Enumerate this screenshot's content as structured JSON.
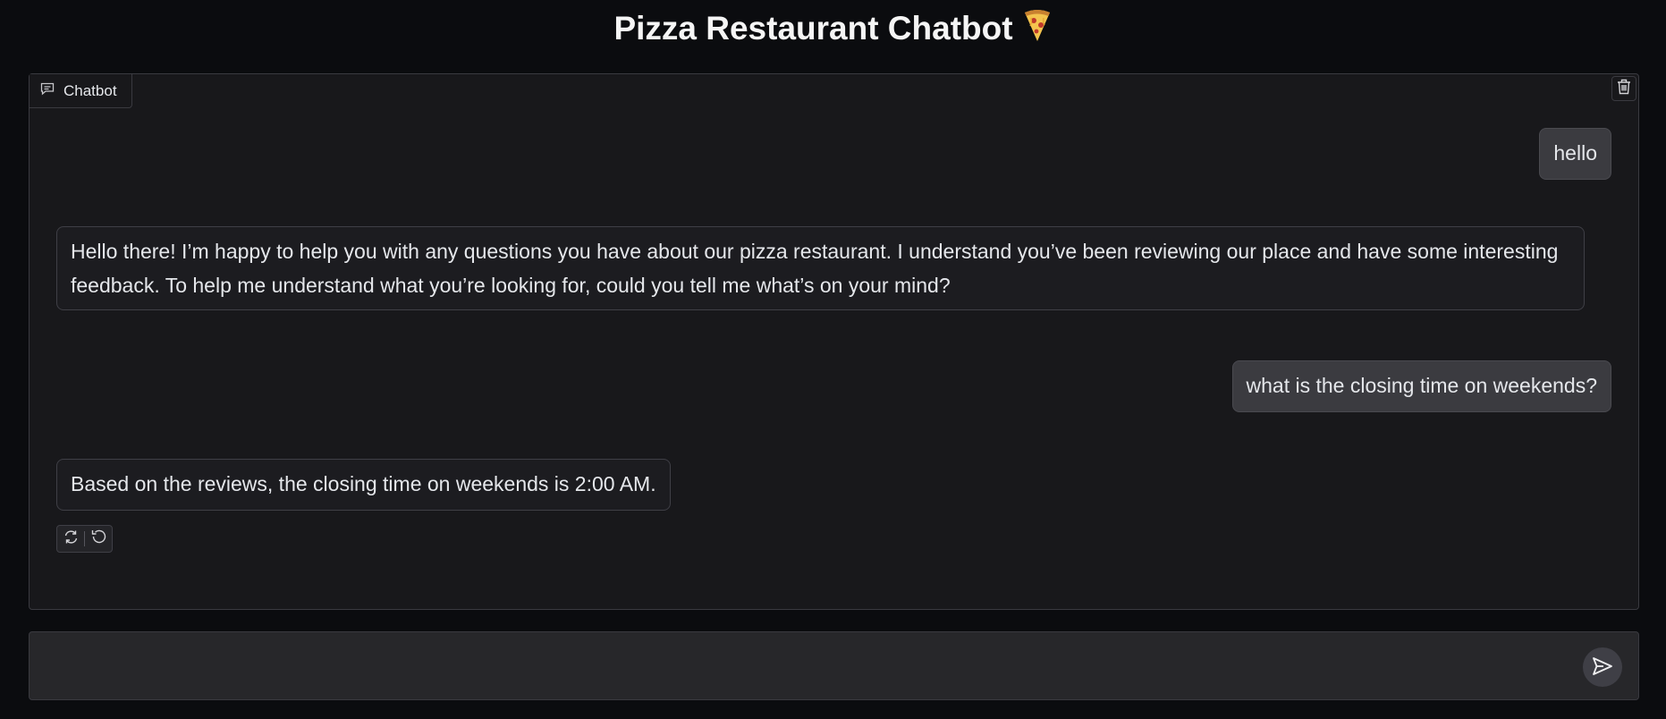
{
  "page": {
    "title": "Pizza Restaurant Chatbot",
    "title_emoji": "🍕"
  },
  "chatbot": {
    "tab_label": "Chatbot",
    "messages": [
      {
        "role": "user",
        "text": "hello"
      },
      {
        "role": "assistant",
        "text": "Hello there! I’m happy to help you with any questions you have about our pizza restaurant. I understand you’ve been reviewing our place and have some interesting feedback. To help me understand what you’re looking for, could you tell me what’s on your mind?"
      },
      {
        "role": "user",
        "text": "what is the closing time on weekends?"
      },
      {
        "role": "assistant",
        "text": "Based on the reviews, the closing time on weekends is 2:00 AM."
      }
    ],
    "icons": {
      "tab": "chat-bubble-icon",
      "clear": "trash-icon",
      "retry": "retry-icon",
      "undo": "undo-icon"
    }
  },
  "input": {
    "value": "",
    "placeholder": "",
    "send_icon": "send-icon"
  }
}
